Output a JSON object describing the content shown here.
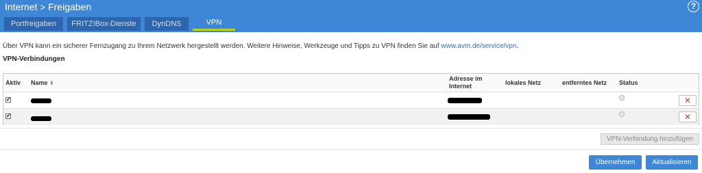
{
  "header": {
    "breadcrumb": {
      "section": "Internet",
      "separator": ">",
      "page": "Freigaben"
    },
    "help_label": "?"
  },
  "tabs": [
    {
      "label": "Portfreigaben",
      "active": false
    },
    {
      "label": "FRITZ!Box-Dienste",
      "active": false
    },
    {
      "label": "DynDNS",
      "active": false
    },
    {
      "label": "VPN",
      "active": true
    }
  ],
  "intro": {
    "text": "Über VPN kann ein sicherer Fernzugang zu Ihrem Netzwerk hergestellt werden. Weitere Hinweise, Werkzeuge und Tipps zu VPN finden Sie auf ",
    "link": "www.avm.de/service/vpn",
    "suffix": "."
  },
  "section_title": "VPN-Verbindungen",
  "table": {
    "columns": {
      "aktiv": "Aktiv",
      "name": "Name",
      "sort_icon": "⬍",
      "adresse_line1": "Adresse im",
      "adresse_line2": "Internet",
      "lokales": "lokales Netz",
      "entferntes": "entferntes Netz",
      "status": "Status"
    },
    "rows": [
      {
        "checked_mark": "✔",
        "name_redacted": true,
        "address_redacted": true,
        "lokales_netz": "",
        "entferntes_netz": "",
        "status": "inactive",
        "delete_label": "✕"
      },
      {
        "checked_mark": "✔",
        "name_redacted": true,
        "address_redacted": true,
        "lokales_netz": "",
        "entferntes_netz": "",
        "status": "inactive",
        "delete_label": "✕"
      }
    ]
  },
  "buttons": {
    "add_vpn": "VPN-Verbindung hinzufügen",
    "apply": "Übernehmen",
    "refresh": "Aktualisieren"
  },
  "colors": {
    "header_blue": "#3d87d6",
    "tab_dark": "#2d66ad",
    "active_tab_underline": "#b9d80f",
    "delete_red": "#e03c1c"
  }
}
